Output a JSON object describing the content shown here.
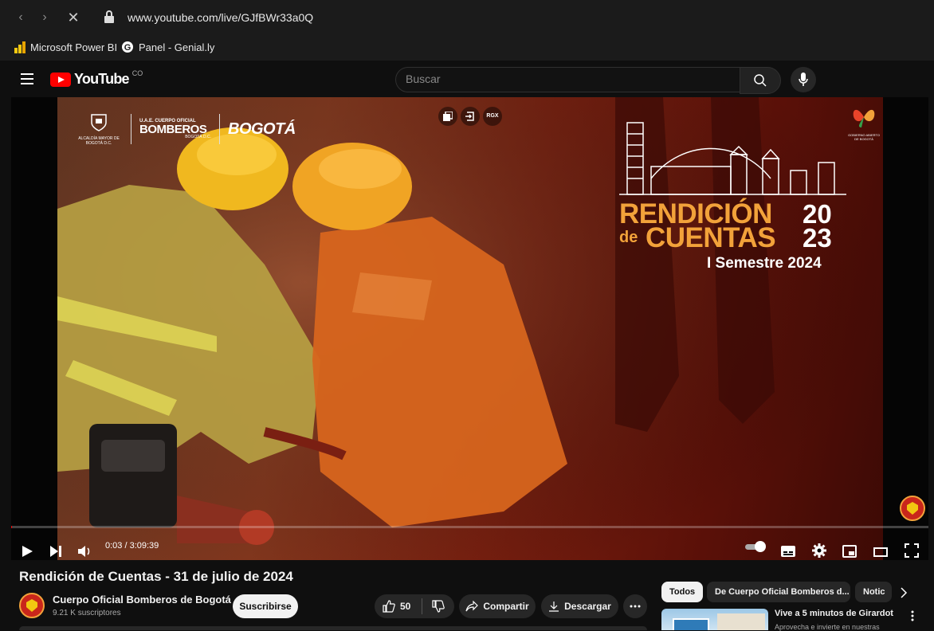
{
  "browser": {
    "url": "www.youtube.com/live/GJfBWr33a0Q",
    "bookmarks": [
      {
        "label": "Microsoft Power BI",
        "icon": "powerbi-icon"
      },
      {
        "label": "Panel - Genial.ly",
        "icon": "genially-icon"
      }
    ]
  },
  "header": {
    "logo_text": "YouTube",
    "country_code": "CO",
    "search_placeholder": "Buscar"
  },
  "video": {
    "overlay": {
      "org_line1": "U.A.E. CUERPO OFICIAL",
      "org_line2": "BOMBEROS",
      "org_line3": "BOGOTÁ D.C.",
      "alcaldia": "ALCALDÍA MAYOR DE BOGOTÁ D.C.",
      "bogota": "BOGOTÁ",
      "gobierno": "GOBIERNO ABIERTO DE BOGOTÁ",
      "rendicion": "RENDICIÓN",
      "de": "de",
      "cuentas": "CUENTAS",
      "year_top": "20",
      "year_bottom": "23",
      "semestre": "I Semestre 2024",
      "rgx": "RGX"
    },
    "time": "0:03 / 3:09:39",
    "progress": 0.0003
  },
  "info": {
    "title": "Rendición de Cuentas - 31 de julio de 2024",
    "channel": "Cuerpo Oficial Bomberos de Bogotá",
    "subscribers": "9.21 K suscriptores",
    "subscribe_label": "Suscribirse",
    "likes": "50",
    "share_label": "Compartir",
    "download_label": "Descargar"
  },
  "sidebar": {
    "chips": [
      "Todos",
      "De Cuerpo Oficial Bomberos d...",
      "Notic"
    ],
    "rec_title": "Vive a 5 minutos de Girardot",
    "rec_sub": "Aprovecha e invierte en nuestras"
  },
  "colors": {
    "accent": "#ff0000",
    "bg": "#0f0f0f",
    "fire_orange": "#f2a23a"
  }
}
